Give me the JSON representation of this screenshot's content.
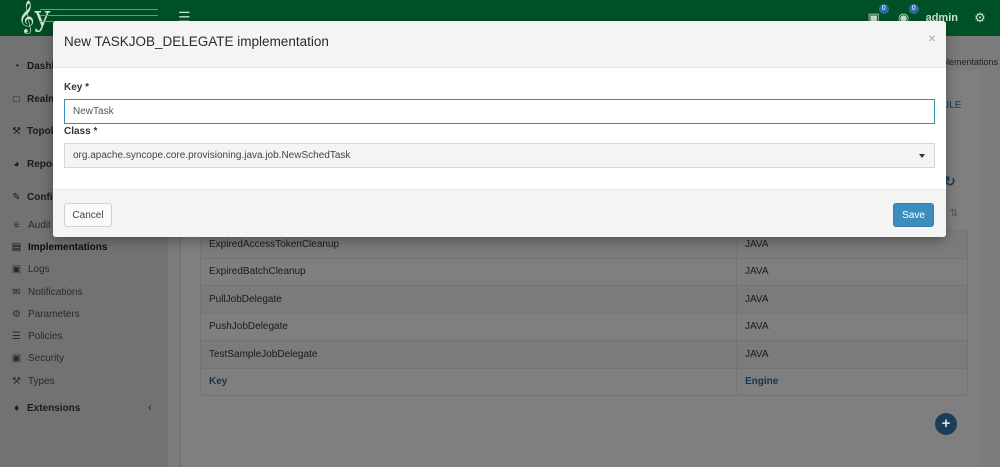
{
  "colors": {
    "brand_green": "#005226",
    "primary": "#3c8dbc"
  },
  "topbar": {
    "logo_text": "𝄞y",
    "badge_1": "0",
    "badge_2": "0",
    "user": "admin"
  },
  "sidebar": {
    "items": [
      {
        "label": "Dashb",
        "icon": "dashboard-icon"
      },
      {
        "label": "Realm",
        "icon": "folder-icon"
      },
      {
        "label": "Topolo",
        "icon": "wrench-icon"
      },
      {
        "label": "Repor",
        "icon": "pie-chart-icon"
      },
      {
        "label": "Config",
        "icon": "edit-icon"
      }
    ],
    "sub_items": [
      {
        "label": "Audit",
        "icon": "list-icon"
      },
      {
        "label": "Implementations",
        "icon": "file-icon"
      },
      {
        "label": "Logs",
        "icon": "file-text-icon"
      },
      {
        "label": "Notifications",
        "icon": "envelope-icon"
      },
      {
        "label": "Parameters",
        "icon": "gear-icon"
      },
      {
        "label": "Policies",
        "icon": "list-icon"
      },
      {
        "label": "Security",
        "icon": "lock-icon"
      },
      {
        "label": "Types",
        "icon": "wrench-icon"
      }
    ],
    "extensions": "Extensions"
  },
  "background": {
    "breadcrumb": "plementations",
    "link_text": "ULE",
    "table_rows": [
      {
        "key": "ExpiredAccessTokenCleanup",
        "engine": "JAVA"
      },
      {
        "key": "ExpiredBatchCleanup",
        "engine": "JAVA"
      },
      {
        "key": "PullJobDelegate",
        "engine": "JAVA"
      },
      {
        "key": "PushJobDelegate",
        "engine": "JAVA"
      },
      {
        "key": "TestSampleJobDelegate",
        "engine": "JAVA"
      }
    ],
    "table_footer": {
      "key": "Key",
      "engine": "Engine"
    }
  },
  "modal": {
    "title": "New TASKJOB_DELEGATE implementation",
    "key_label": "Key *",
    "key_value": "NewTask",
    "class_label": "Class *",
    "class_value": "org.apache.syncope.core.provisioning.java.job.NewSchedTask",
    "cancel_label": "Cancel",
    "save_label": "Save"
  }
}
